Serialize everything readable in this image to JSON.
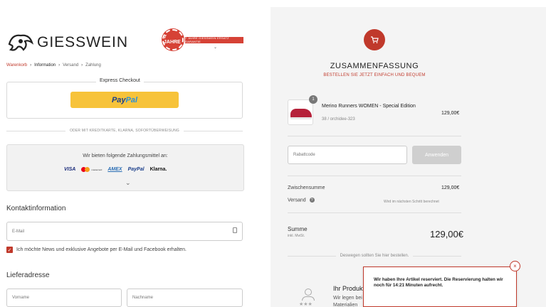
{
  "brand": {
    "name": "GIESSWEIN",
    "seal_text": "7 JAHRE",
    "guarantee_text": "7 JAHRE GIESSWEIN ERSATZ GARANTIE"
  },
  "breadcrumb": [
    {
      "label": "Warenkorb",
      "state": "link"
    },
    {
      "label": "Information",
      "state": "active"
    },
    {
      "label": "Versand",
      "state": "inactive"
    },
    {
      "label": "Zahlung",
      "state": "inactive"
    }
  ],
  "express": {
    "title": "Express Checkout",
    "paypal_part1": "Pay",
    "paypal_part2": "Pal"
  },
  "divider_text": "ODER MIT KREDITKARTE, KLARNA, SOFORTÜBERWEISUNG",
  "payment": {
    "intro": "Wir bieten folgende Zahlungsmittel an:",
    "visa": "VISA",
    "mastercard": "mastercard",
    "amex": "AMEX",
    "paypal": "PayPal",
    "klarna": "Klarna."
  },
  "contact": {
    "title": "Kontaktinformation",
    "email_placeholder": "E-Mail",
    "newsletter_label": "Ich möchte News und exklusive Angebote per E-Mail und Facebook erhalten.",
    "newsletter_checked": true
  },
  "shipping": {
    "title": "Lieferadresse",
    "firstname_placeholder": "Vorname",
    "lastname_placeholder": "Nachname"
  },
  "summary": {
    "title": "ZUSAMMENFASSUNG",
    "subtitle": "BESTELLEN SIE JETZT EINFACH UND BEQUEM",
    "accent_color": "#c0392b",
    "product": {
      "quantity": "1",
      "name": "Merino Runners WOMEN - Special Edition",
      "variant": "38 / orchidee-323",
      "price": "129,00€"
    },
    "coupon_placeholder": "Rabattcode",
    "coupon_button": "Anwenden",
    "subtotal_label": "Zwischensumme",
    "subtotal_value": "129,00€",
    "shipping_label": "Versand",
    "shipping_value": "Wird im nächsten Schritt berechnet",
    "total_label": "Summe",
    "total_sub": "inkl. MwSt.",
    "total_value": "129,00€",
    "why_text": "Deswegen sollten Sie hier bestellen.",
    "ihr_title": "Ihr Produkt",
    "ihr_text": "Wir legen bei Materialien"
  },
  "popup": {
    "text": "Wir haben Ihre Artikel reserviert. Die Reservierung halten wir noch für 14:21 Minuten aufrecht.",
    "close_label": "×"
  }
}
